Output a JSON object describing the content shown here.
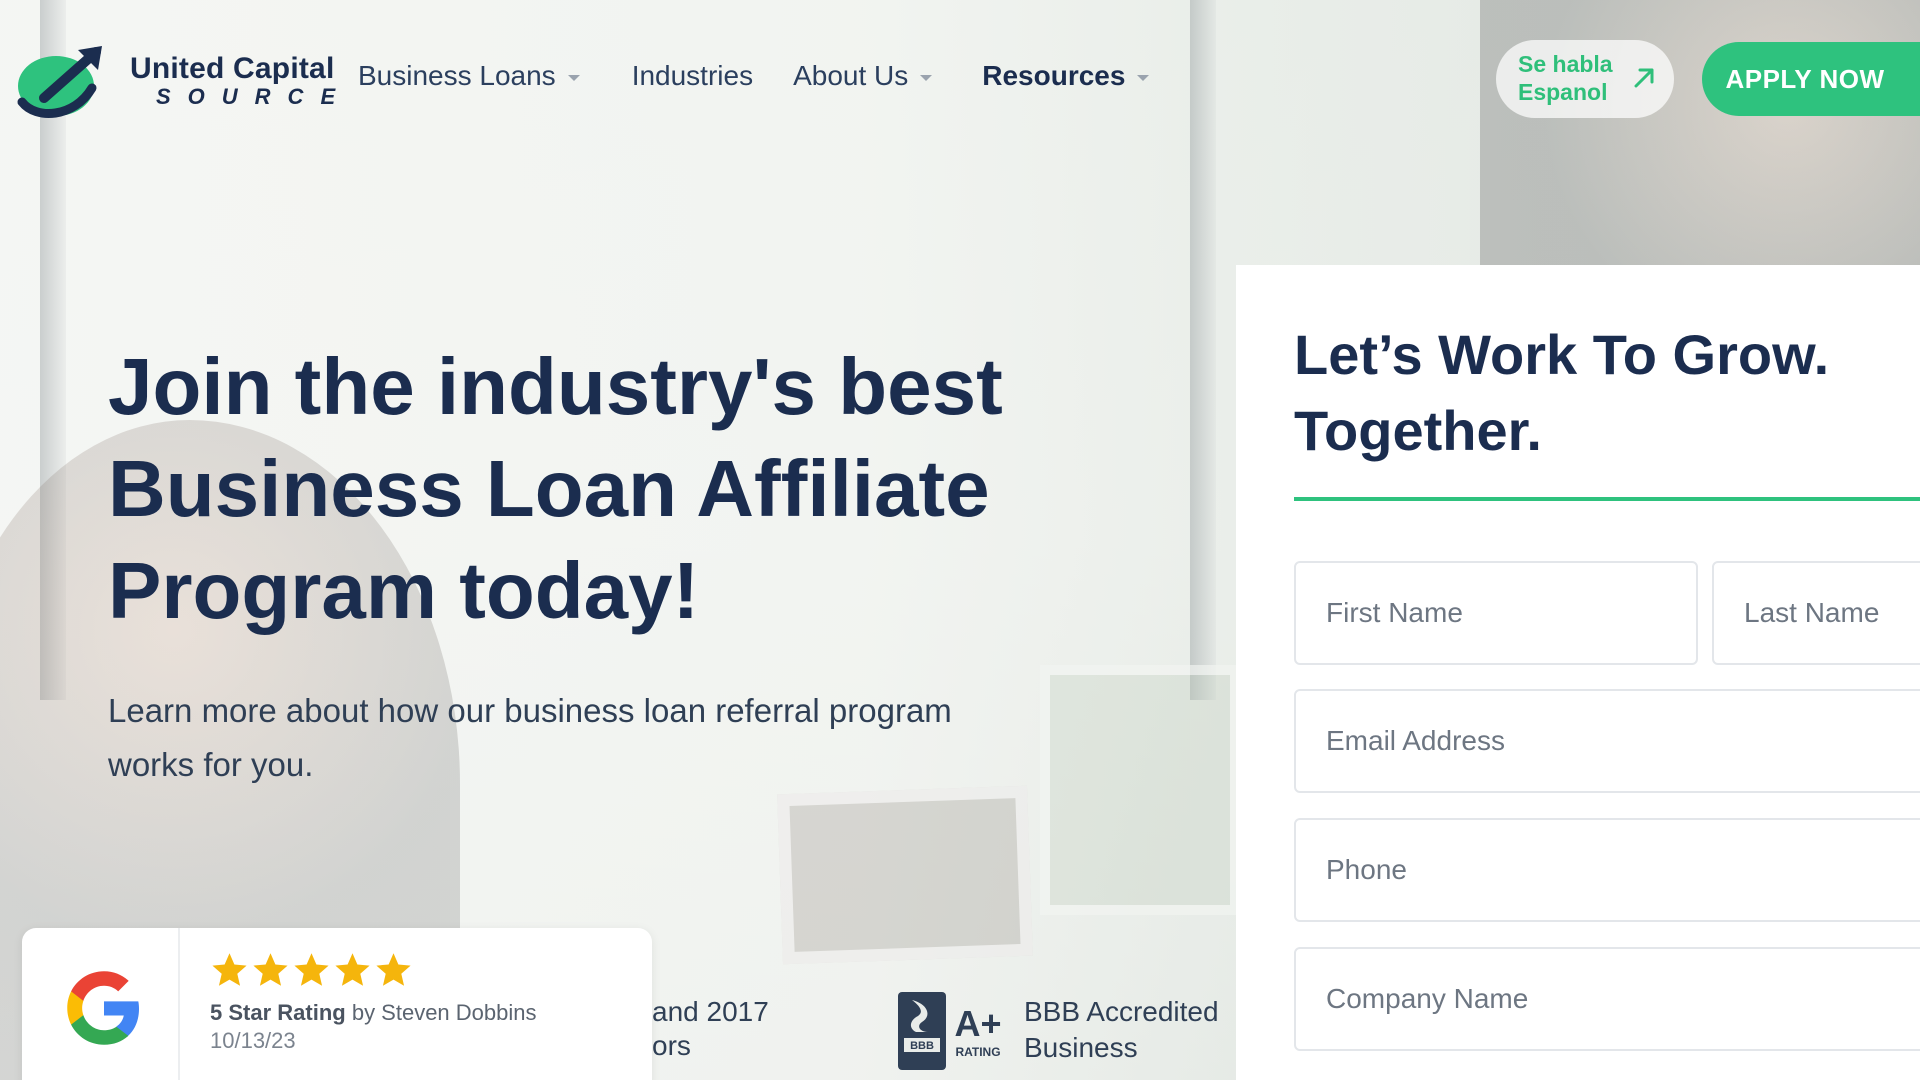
{
  "brand": {
    "name_line1": "United Capital",
    "name_line2": "SOURCE",
    "navy": "#1b2d4f",
    "green": "#2ec27e"
  },
  "nav": {
    "items": [
      {
        "label": "Business Loans",
        "dropdown": true
      },
      {
        "label": "Industries",
        "dropdown": false
      },
      {
        "label": "About Us",
        "dropdown": true
      },
      {
        "label": "Resources",
        "dropdown": true
      }
    ]
  },
  "header": {
    "spanish_link": "Se habla Espanol",
    "apply_button": "APPLY NOW",
    "arrow_icon": "external-arrow-icon"
  },
  "hero": {
    "headline": "Join the industry's best Business Loan Affiliate Program today!",
    "subtext": "Learn more about how our business loan referral program works for you."
  },
  "review": {
    "icon": "google-icon",
    "stars": 5,
    "rating_label": "5 Star Rating",
    "by_text": "by Steven Dobbins",
    "date": "10/13/23"
  },
  "awards": {
    "partial_line1": "and 2017",
    "partial_line2": "ors",
    "bbb_line1": "BBB Accredited",
    "bbb_line2": "Business",
    "bbb_badge": "A+",
    "bbb_rating_word": "RATING"
  },
  "form": {
    "title": "Let’s Work To Grow. Together.",
    "fields": {
      "first_name": "First Name",
      "last_name": "Last Name",
      "email": "Email Address",
      "phone": "Phone",
      "company": "Company Name"
    }
  }
}
